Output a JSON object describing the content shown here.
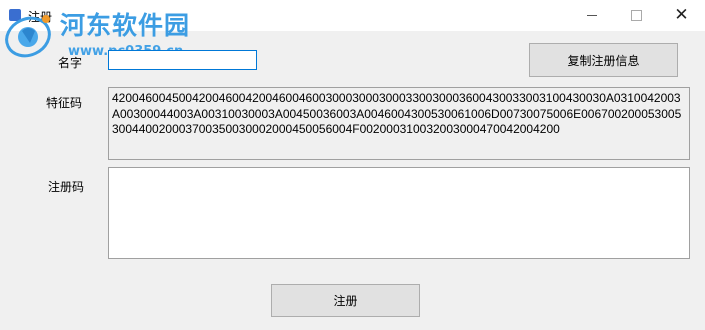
{
  "window": {
    "title": "注册",
    "icon": "app-icon",
    "controls": [
      "minimize-icon",
      "maximize-icon",
      "close-icon"
    ]
  },
  "watermark": {
    "title": "河东软件园",
    "url": "www.pc0359.cn"
  },
  "form": {
    "name_label": "名字",
    "name_value": "",
    "feature_label": "特征码",
    "feature_value": "42004600450042004600420046004600300030003000330030003600430033003100430030A0310042003A00300044003A00310030003A00450036003A0046004300530061006D00730075006E006700200053005300440020003700350030002000450056004F002000310032003000470042004200",
    "code_label": "注册码",
    "code_value": ""
  },
  "buttons": {
    "copy_label": "复制注册信息",
    "register_label": "注册"
  }
}
